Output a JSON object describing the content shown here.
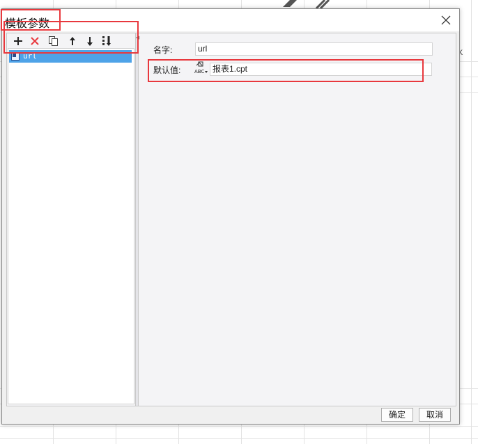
{
  "background": {
    "column_letter": "K",
    "icons": [
      "pen-icon",
      "pencil-icon"
    ]
  },
  "dialog": {
    "title": "模板参数",
    "close_icon": "close-icon"
  },
  "toolbar": {
    "buttons": [
      "add-icon",
      "delete-icon",
      "copy-icon",
      "move-up-icon",
      "move-down-icon",
      "sort-icon"
    ]
  },
  "tree": {
    "items": [
      {
        "label": "url",
        "icon": "parameter-icon",
        "selected": true
      }
    ]
  },
  "form": {
    "name_label": "名字:",
    "name_value": "url",
    "default_label": "默认值:",
    "type_icon": "abc-text-type-icon",
    "default_value": "报表1.cpt"
  },
  "footer": {
    "ok_label": "确定",
    "cancel_label": "取消"
  },
  "colors": {
    "highlight": "#e8383d",
    "selection": "#4ea3e8",
    "delete": "#e8383d"
  }
}
